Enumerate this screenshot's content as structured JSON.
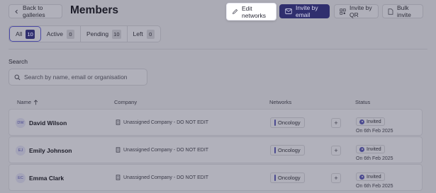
{
  "header": {
    "back_label": "Back to galleries",
    "title": "Members",
    "edit_networks_label": "Edit networks",
    "invite_email_label": "Invite by email",
    "invite_qr_label": "Invite by QR",
    "bulk_invite_label": "Bulk invite"
  },
  "filters": [
    {
      "label": "All",
      "count": "10"
    },
    {
      "label": "Active",
      "count": "0"
    },
    {
      "label": "Pending",
      "count": "10"
    },
    {
      "label": "Left",
      "count": "0"
    }
  ],
  "search": {
    "label": "Search",
    "placeholder": "Search by name, email or organisation",
    "value": ""
  },
  "table": {
    "columns": [
      "Name",
      "Company",
      "Networks",
      "Status"
    ],
    "rows": [
      {
        "initials": "DW",
        "name": "David Wilson",
        "company": "Unassigned Company - DO NOT EDIT",
        "network": "Oncology",
        "status": "Invited",
        "date": "On 6th Feb 2025"
      },
      {
        "initials": "EJ",
        "name": "Emily Johnson",
        "company": "Unassigned Company - DO NOT EDIT",
        "network": "Oncology",
        "status": "Invited",
        "date": "On 6th Feb 2025"
      },
      {
        "initials": "EC",
        "name": "Emma Clark",
        "company": "Unassigned Company - DO NOT EDIT",
        "network": "Oncology",
        "status": "Invited",
        "date": "On 6th Feb 2025"
      }
    ]
  },
  "colors": {
    "accent": "#302f6e",
    "overlay": "#ababb5",
    "highlight": "#ffffff"
  }
}
